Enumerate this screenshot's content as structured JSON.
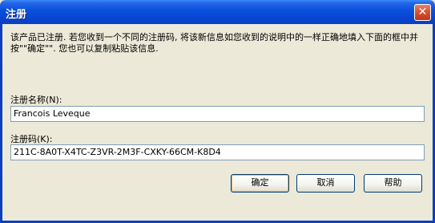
{
  "window": {
    "title": "注册",
    "close_symbol": "✕"
  },
  "description": "该产品已注册. 若您收到一个不同的注册码, 将该新信息如您收到的说明中的一样正确地填入下面的框中并按\"\"确定\"\". 您也可以复制粘贴该信息.",
  "fields": {
    "name_label": "注册名称(N):",
    "name_value": "Francois Leveque",
    "code_label": "注册码(K):",
    "code_value": "211C-8A0T-X4TC-Z3VR-2M3F-CXKY-66CM-K8D4"
  },
  "buttons": {
    "ok": "确定",
    "cancel": "取消",
    "help": "帮助"
  },
  "colors": {
    "titlebar": "#0A52DE",
    "dialog_bg": "#ECE9D8",
    "close_button": "#D4502E"
  }
}
